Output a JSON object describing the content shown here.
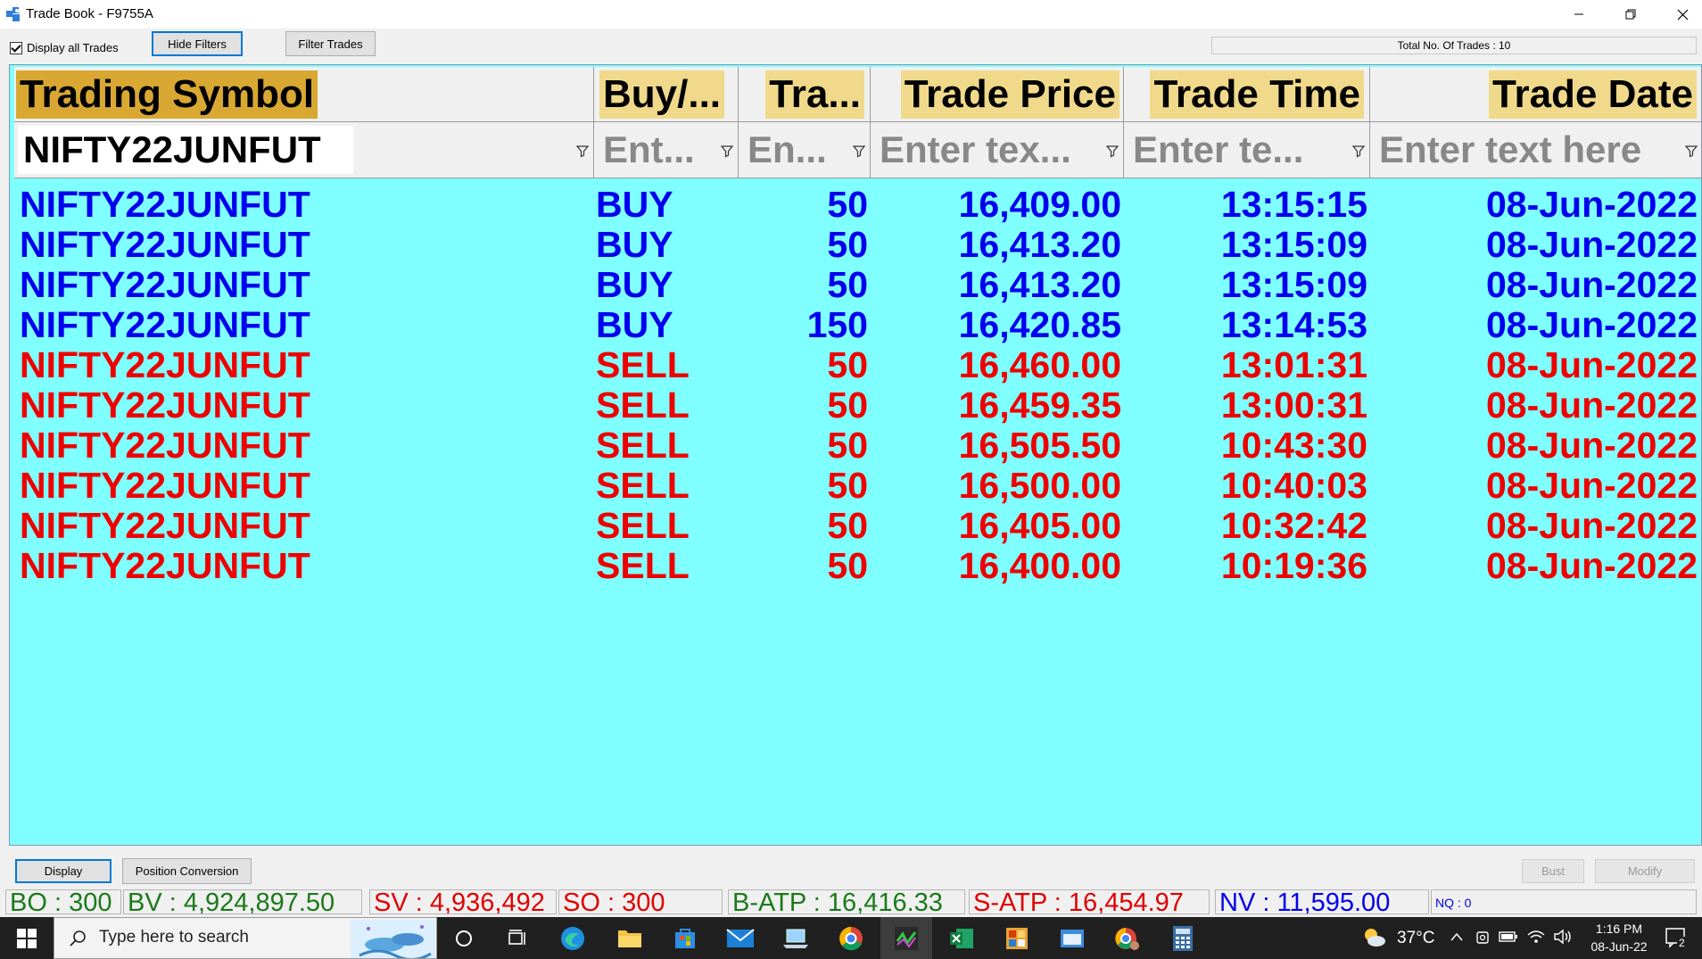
{
  "window": {
    "title": "Trade Book - F9755A"
  },
  "toolbar": {
    "display_all_label": "Display all Trades",
    "display_all_checked": true,
    "hide_filters_label": "Hide Filters",
    "filter_trades_label": "Filter Trades",
    "total_trades": "Total No. Of Trades : 10"
  },
  "grid": {
    "columns": [
      "Trading Symbol",
      "Buy/...",
      "Tra...",
      "Trade Price",
      "Trade Time",
      "Trade Date"
    ],
    "filters": [
      {
        "value": "NIFTY22JUNFUT",
        "placeholder": ""
      },
      {
        "value": "",
        "placeholder": "Ent..."
      },
      {
        "value": "",
        "placeholder": "En..."
      },
      {
        "value": "",
        "placeholder": "Enter tex..."
      },
      {
        "value": "",
        "placeholder": "Enter te..."
      },
      {
        "value": "",
        "placeholder": "Enter text here"
      }
    ],
    "rows": [
      {
        "symbol": "NIFTY22JUNFUT",
        "side": "BUY",
        "qty": "50",
        "price": "16,409.00",
        "time": "13:15:15",
        "date": "08-Jun-2022"
      },
      {
        "symbol": "NIFTY22JUNFUT",
        "side": "BUY",
        "qty": "50",
        "price": "16,413.20",
        "time": "13:15:09",
        "date": "08-Jun-2022"
      },
      {
        "symbol": "NIFTY22JUNFUT",
        "side": "BUY",
        "qty": "50",
        "price": "16,413.20",
        "time": "13:15:09",
        "date": "08-Jun-2022"
      },
      {
        "symbol": "NIFTY22JUNFUT",
        "side": "BUY",
        "qty": "150",
        "price": "16,420.85",
        "time": "13:14:53",
        "date": "08-Jun-2022"
      },
      {
        "symbol": "NIFTY22JUNFUT",
        "side": "SELL",
        "qty": "50",
        "price": "16,460.00",
        "time": "13:01:31",
        "date": "08-Jun-2022"
      },
      {
        "symbol": "NIFTY22JUNFUT",
        "side": "SELL",
        "qty": "50",
        "price": "16,459.35",
        "time": "13:00:31",
        "date": "08-Jun-2022"
      },
      {
        "symbol": "NIFTY22JUNFUT",
        "side": "SELL",
        "qty": "50",
        "price": "16,505.50",
        "time": "10:43:30",
        "date": "08-Jun-2022"
      },
      {
        "symbol": "NIFTY22JUNFUT",
        "side": "SELL",
        "qty": "50",
        "price": "16,500.00",
        "time": "10:40:03",
        "date": "08-Jun-2022"
      },
      {
        "symbol": "NIFTY22JUNFUT",
        "side": "SELL",
        "qty": "50",
        "price": "16,405.00",
        "time": "10:32:42",
        "date": "08-Jun-2022"
      },
      {
        "symbol": "NIFTY22JUNFUT",
        "side": "SELL",
        "qty": "50",
        "price": "16,400.00",
        "time": "10:19:36",
        "date": "08-Jun-2022"
      }
    ]
  },
  "bottom": {
    "display_label": "Display",
    "position_conversion_label": "Position Conversion",
    "bust_label": "Bust",
    "modify_label": "Modify"
  },
  "stats": {
    "bo": "BO : 300",
    "bv": "BV : 4,924,897.50",
    "sv": "SV : 4,936,492",
    "so": "SO : 300",
    "batp": "B-ATP : 16,416.33",
    "satp": "S-ATP : 16,454.97",
    "nv": "NV : 11,595.00",
    "nq": "NQ : 0"
  },
  "colors": {
    "grid_bg": "#7fffff",
    "buy": "#0000ee",
    "sell": "#ee0000",
    "header_label_bg": "#f0d98a",
    "header_active_bg": "#d8a832",
    "stat_green": "#1a7a1a"
  },
  "taskbar": {
    "search_placeholder": "Type here to search",
    "icons": [
      "windows-start-icon",
      "cortana-icon",
      "task-view-icon",
      "edge-icon",
      "file-explorer-icon",
      "store-icon",
      "mail-icon",
      "laptop-app-icon",
      "chrome-icon",
      "trading-app-icon",
      "excel-icon",
      "office-app-icon",
      "window-app-icon",
      "chrome-profile-icon",
      "calculator-icon"
    ],
    "weather": "37°C",
    "time": "1:16 PM",
    "date": "08-Jun-22",
    "notification_count": "2"
  }
}
